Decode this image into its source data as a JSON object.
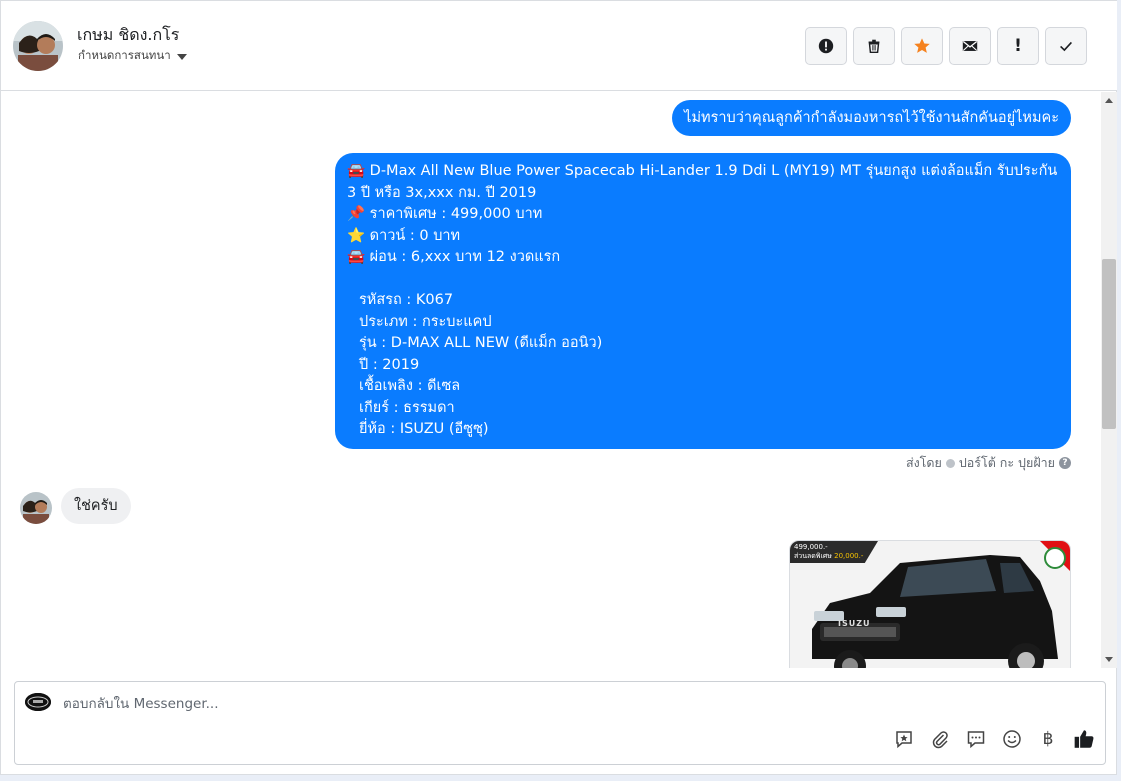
{
  "header": {
    "contact_name": "เกษม ชิดง.กโร",
    "assign_label": "กำหนดการสนทนา",
    "actions": [
      {
        "icon": "alert-circle-icon"
      },
      {
        "icon": "trash-icon"
      },
      {
        "icon": "star-icon",
        "color": "#f5821f"
      },
      {
        "icon": "envelope-icon"
      },
      {
        "icon": "exclamation-icon",
        "label": "!"
      },
      {
        "icon": "check-icon"
      }
    ]
  },
  "messages": {
    "out_short": "ไม่ทราบว่าคุณลูกค้ากำลังมองหารถไว้ใช้งานสักคันอยู่ไหมคะ",
    "out_long": {
      "line1": "🚘 D-Max All New Blue Power Spacecab Hi-Lander 1.9 Ddi L (MY19) MT รุ่นยกสูง แต่งล้อแม็ก รับประกัน",
      "line2": "3 ปี หรือ 3x,xxx กม. ปี 2019",
      "line3": "📌 ราคาพิเศษ : 499,000 บาท",
      "line4": "⭐ ดาวน์ : 0 บาท",
      "line5": "🚘 ผ่อน : 6,xxx บาท 12 งวดแรก",
      "code": "รหัสรถ : K067",
      "type": "ประเภท : กระบะแคป",
      "model": "รุ่น : D-MAX ALL NEW (ดีแม็ก ออนิว)",
      "year": "ปี : 2019",
      "fuel": "เชื้อเพลิง : ดีเซล",
      "gear": "เกียร์ : ธรรมดา",
      "brand": "ยี่ห้อ : ISUZU (อีซูซุ)"
    },
    "sent_by_label": "ส่งโดย",
    "sent_by_name": "ปอร์โต้ กะ ปุยฝ้าย",
    "in_reply": "ใช่ครับ",
    "image_promo": {
      "price": "499,000.-",
      "discount_label": "ส่วนลดพิเศษ",
      "discount_value": "20,000.-",
      "grille_text": "ISUZU"
    }
  },
  "composer": {
    "placeholder": "ตอบกลับใน Messenger...",
    "baht_symbol": "฿"
  },
  "colors": {
    "accent": "#0a7cff",
    "incoming_bubble": "#eff0f2"
  }
}
